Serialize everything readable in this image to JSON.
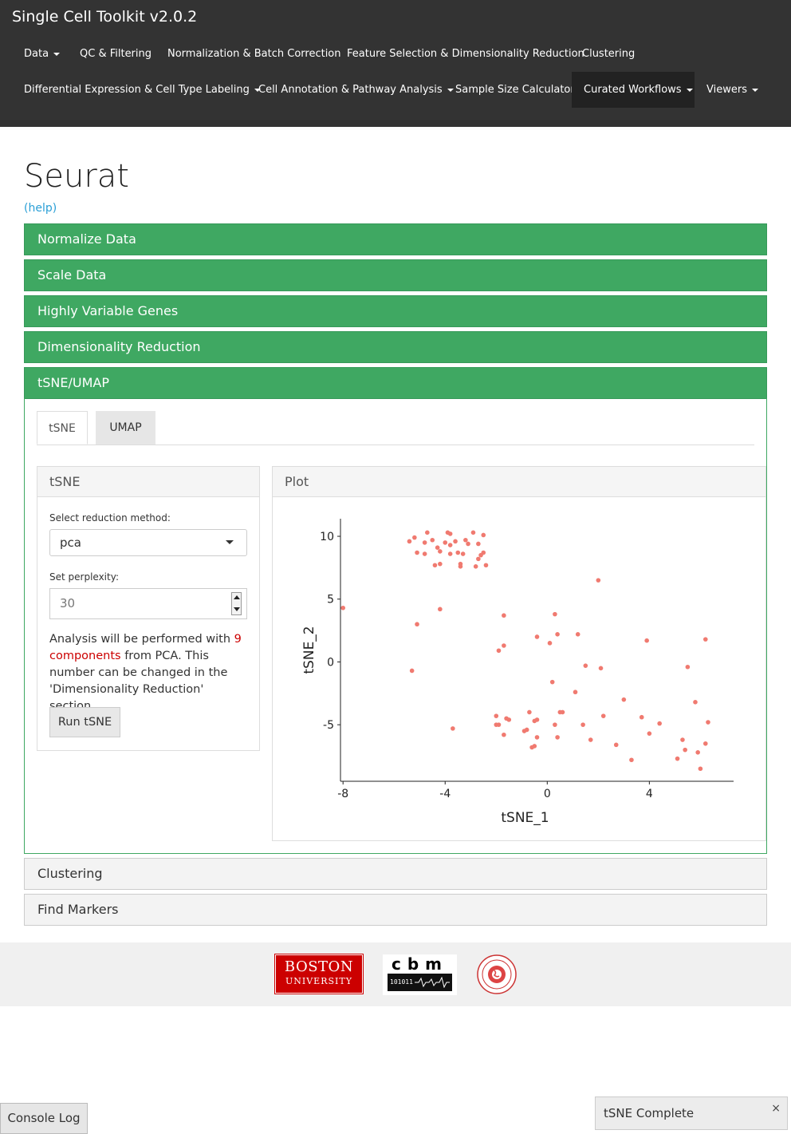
{
  "app": {
    "title": "Single Cell Toolkit v2.0.2"
  },
  "nav": [
    {
      "label": "Data",
      "dropdown": true
    },
    {
      "label": "QC & Filtering",
      "dropdown": false
    },
    {
      "label": "Normalization & Batch Correction",
      "dropdown": false
    },
    {
      "label": "Feature Selection & Dimensionality Reduction",
      "dropdown": false
    },
    {
      "label": "Clustering",
      "dropdown": false
    },
    {
      "label": "Differential Expression & Cell Type Labeling",
      "dropdown": true
    },
    {
      "label": "Cell Annotation & Pathway Analysis",
      "dropdown": true
    },
    {
      "label": "Sample Size Calculator",
      "dropdown": false
    },
    {
      "label": "Curated Workflows",
      "dropdown": true,
      "active": true
    },
    {
      "label": "Viewers",
      "dropdown": true
    }
  ],
  "page": {
    "title": "Seurat",
    "help": "(help)"
  },
  "sections": {
    "normalize": "Normalize Data",
    "scale": "Scale Data",
    "hvg": "Highly Variable Genes",
    "dimred": "Dimensionality Reduction",
    "tsne_umap": "tSNE/UMAP",
    "clustering": "Clustering",
    "markers": "Find Markers"
  },
  "tabs": {
    "tsne": "tSNE",
    "umap": "UMAP"
  },
  "tsne_panel": {
    "title": "tSNE",
    "reduction_label": "Select reduction method:",
    "reduction_value": "pca",
    "perplexity_label": "Set perplexity:",
    "perplexity_value": "30",
    "info_pre": "Analysis will be performed with ",
    "info_components": "9 components",
    "info_post": " from PCA. This number can be changed in the 'Dimensionality Reduction' section.",
    "run_button": "Run tSNE"
  },
  "plot_panel": {
    "title": "Plot"
  },
  "chart_data": {
    "type": "scatter",
    "xlabel": "tSNE_1",
    "ylabel": "tSNE_2",
    "xlim": [
      -8.1,
      7.3
    ],
    "ylim": [
      -9.5,
      11.4
    ],
    "xticks": [
      -8,
      -4,
      0,
      4
    ],
    "yticks": [
      -5,
      0,
      5,
      10
    ],
    "point_color": "#f07a70",
    "points": [
      [
        -8.0,
        4.3
      ],
      [
        -5.3,
        -0.7
      ],
      [
        -5.1,
        3.0
      ],
      [
        -4.2,
        4.2
      ],
      [
        -3.7,
        -5.3
      ],
      [
        -5.4,
        9.6
      ],
      [
        -5.2,
        9.9
      ],
      [
        -5.1,
        8.7
      ],
      [
        -4.8,
        8.6
      ],
      [
        -4.8,
        9.5
      ],
      [
        -4.7,
        10.3
      ],
      [
        -4.5,
        9.7
      ],
      [
        -4.4,
        7.7
      ],
      [
        -4.3,
        9.1
      ],
      [
        -4.2,
        8.8
      ],
      [
        -4.2,
        7.8
      ],
      [
        -4.0,
        9.5
      ],
      [
        -3.9,
        10.3
      ],
      [
        -3.8,
        10.2
      ],
      [
        -3.8,
        9.3
      ],
      [
        -3.8,
        8.6
      ],
      [
        -3.6,
        9.6
      ],
      [
        -3.5,
        8.7
      ],
      [
        -3.4,
        7.8
      ],
      [
        -3.4,
        7.6
      ],
      [
        -3.3,
        8.6
      ],
      [
        -3.2,
        9.7
      ],
      [
        -3.1,
        9.4
      ],
      [
        -2.9,
        10.3
      ],
      [
        -2.8,
        7.6
      ],
      [
        -2.7,
        8.2
      ],
      [
        -2.7,
        9.4
      ],
      [
        -2.5,
        8.7
      ],
      [
        -2.5,
        10.1
      ],
      [
        -2.4,
        7.7
      ],
      [
        -2.6,
        8.5
      ],
      [
        -1.7,
        3.7
      ],
      [
        -1.7,
        1.3
      ],
      [
        -1.9,
        0.9
      ],
      [
        -2.0,
        -4.3
      ],
      [
        -2.0,
        -5.0
      ],
      [
        -1.9,
        -5.0
      ],
      [
        -1.7,
        -5.8
      ],
      [
        -1.5,
        -4.6
      ],
      [
        -1.6,
        -4.5
      ],
      [
        -0.9,
        -5.5
      ],
      [
        -0.8,
        -5.4
      ],
      [
        -0.7,
        -4.0
      ],
      [
        -0.6,
        -6.8
      ],
      [
        -0.5,
        -6.7
      ],
      [
        -0.5,
        -4.7
      ],
      [
        -0.4,
        -6.0
      ],
      [
        -0.4,
        -4.6
      ],
      [
        -0.4,
        2.0
      ],
      [
        0.1,
        1.5
      ],
      [
        0.2,
        -1.6
      ],
      [
        0.3,
        -5.0
      ],
      [
        0.3,
        3.8
      ],
      [
        0.4,
        2.2
      ],
      [
        0.4,
        -6.0
      ],
      [
        0.5,
        -4.0
      ],
      [
        0.6,
        -4.0
      ],
      [
        1.1,
        -2.4
      ],
      [
        1.2,
        2.2
      ],
      [
        1.4,
        -5.0
      ],
      [
        1.5,
        -0.3
      ],
      [
        1.7,
        -6.2
      ],
      [
        2.0,
        6.5
      ],
      [
        2.1,
        -0.5
      ],
      [
        2.2,
        -4.3
      ],
      [
        2.7,
        -6.6
      ],
      [
        3.0,
        -3.0
      ],
      [
        3.3,
        -7.8
      ],
      [
        3.7,
        -4.4
      ],
      [
        3.9,
        1.7
      ],
      [
        4.0,
        -5.7
      ],
      [
        4.4,
        -4.9
      ],
      [
        5.1,
        -7.7
      ],
      [
        5.3,
        -6.2
      ],
      [
        5.4,
        -7.0
      ],
      [
        5.5,
        -0.4
      ],
      [
        5.8,
        -3.2
      ],
      [
        5.9,
        -7.2
      ],
      [
        6.0,
        -8.5
      ],
      [
        6.2,
        -6.5
      ],
      [
        6.3,
        -4.8
      ],
      [
        6.2,
        1.8
      ]
    ]
  },
  "footer": {
    "bu_line1": "BOSTON",
    "bu_line2": "UNIVERSITY",
    "cbm_letters": "cbm",
    "cbm_band": "101011"
  },
  "console": {
    "label": "Console Log"
  },
  "toast": {
    "message": "tSNE Complete",
    "close": "×"
  }
}
